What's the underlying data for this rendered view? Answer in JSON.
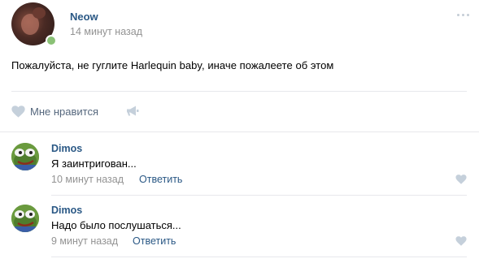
{
  "post": {
    "author": "Neow",
    "time": "14 минут назад",
    "text": "Пожалуйста, не гуглите Harlequin baby, иначе пожалеете об этом",
    "like_label": "Мне нравится",
    "online": true
  },
  "comments": [
    {
      "author": "Dimos",
      "text": "Я заинтригован...",
      "time": "10 минут назад",
      "reply_label": "Ответить"
    },
    {
      "author": "Dimos",
      "text": "Надо было послушаться...",
      "time": "9 минут назад",
      "reply_label": "Ответить"
    }
  ],
  "colors": {
    "link": "#2a5885",
    "muted": "#939393",
    "online": "#8ac176",
    "icon": "#c5d0db"
  },
  "icons": [
    "more-icon",
    "heart-icon",
    "share-megaphone-icon"
  ]
}
